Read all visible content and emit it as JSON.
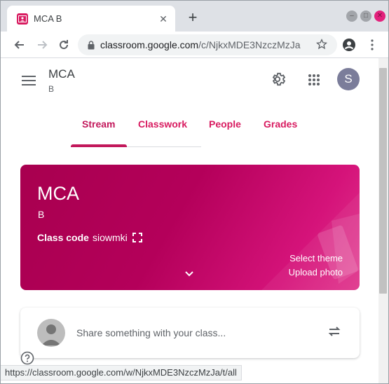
{
  "browser": {
    "tab_title": "MCA B",
    "tab_close": "✕",
    "new_tab": "+",
    "url_host": "classroom.google.com",
    "url_path": "/c/NjkxMDE3NzczMzJa",
    "status_url": "https://classroom.google.com/w/NjkxMDE3NzczMzJa/t/all",
    "win_controls": [
      "–",
      "□",
      "✕"
    ],
    "accent_color": "#d81b60"
  },
  "header": {
    "class_title": "MCA",
    "class_section": "B",
    "avatar_letter": "S"
  },
  "tabs": [
    {
      "label": "Stream",
      "active": true
    },
    {
      "label": "Classwork",
      "active": false
    },
    {
      "label": "People",
      "active": false
    },
    {
      "label": "Grades",
      "active": false
    }
  ],
  "banner": {
    "title": "MCA",
    "section": "B",
    "class_code_label": "Class code",
    "class_code_value": "siowmki",
    "select_theme": "Select theme",
    "upload_photo": "Upload photo",
    "color": "#b4005a"
  },
  "share": {
    "placeholder": "Share something with your class..."
  },
  "icons": {
    "tab_favicon": "classroom-icon",
    "back": "back-arrow-icon",
    "forward": "forward-arrow-icon",
    "reload": "reload-icon",
    "lock": "lock-icon",
    "star": "star-icon",
    "profile": "account-circle-icon",
    "menu": "hamburger-menu-icon",
    "settings": "gear-icon",
    "apps": "apps-grid-icon",
    "fullscreen": "fullscreen-icon",
    "expand": "chevron-down-icon",
    "repost": "repost-icon",
    "help": "help-icon"
  }
}
